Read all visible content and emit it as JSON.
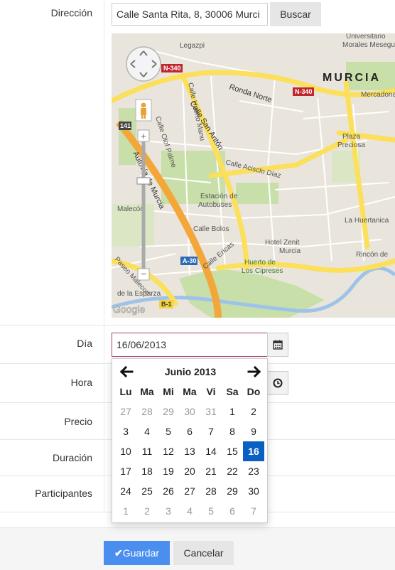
{
  "form": {
    "address": {
      "label": "Dirección",
      "value": "Calle Santa Rita, 8, 30006 Murci",
      "search_label": "Buscar"
    },
    "day": {
      "label": "Día",
      "value": "16/06/2013"
    },
    "hour": {
      "label": "Hora"
    },
    "price": {
      "label": "Precio"
    },
    "duration": {
      "label": "Duración"
    },
    "participants": {
      "label": "Participantes"
    }
  },
  "map": {
    "labels": {
      "murcia": "MURCIA",
      "universitario": "Universitario",
      "morales": "Morales Meseguer",
      "mercadona": "Mercadona",
      "plaza": "Plaza",
      "preciosa": "Preciosa",
      "ronda_norte": "Ronda Norte",
      "n340_a": "N-340",
      "n340_b": "N-340",
      "calle_huerto": "Calle Huerto Manu",
      "calle_san_anton": "Calle San Antón",
      "calle_olof": "Calle Olof Palme",
      "calle_acisclo": "Calle Acisclo Díaz",
      "estacion": "Estación de",
      "autobuses": "Autobuses",
      "autovia": "Autovía de Murcia",
      "calle_bolos": "Calle Bolos",
      "calle_ericas": "Calle Ericas",
      "hotel_zenit": "Hotel Zenit",
      "hotel_murcia": "Murcia",
      "huerto": "Huerto de",
      "cipreses": "Los Cipreses",
      "huertanica": "La Huertanica",
      "rincon": "Rincón de",
      "malecon": "Malecón",
      "paseo_malecon": "Paseo Malecon",
      "esparza": "de la Esparza",
      "a30": "A-30",
      "b1": "B-1",
      "n141": "141",
      "lagazpi": "Legazpi",
      "google": "Google"
    },
    "colors": {
      "land": "#e9e5dc",
      "road": "#ffffff",
      "major": "#fcdf5a",
      "highway": "#f3a73a",
      "park": "#c8dfaa",
      "water": "#9ec3e8"
    }
  },
  "calendar": {
    "title": "Junio 2013",
    "weekdays": [
      "Lu",
      "Ma",
      "Mi",
      "Ma",
      "Vi",
      "Sa",
      "Do"
    ],
    "weeks": [
      [
        "27",
        "28",
        "29",
        "30",
        "31",
        "1",
        "2"
      ],
      [
        "3",
        "4",
        "5",
        "6",
        "7",
        "8",
        "9"
      ],
      [
        "10",
        "11",
        "12",
        "13",
        "14",
        "15",
        "16"
      ],
      [
        "17",
        "18",
        "19",
        "20",
        "21",
        "22",
        "23"
      ],
      [
        "24",
        "25",
        "26",
        "27",
        "28",
        "29",
        "30"
      ],
      [
        "1",
        "2",
        "3",
        "4",
        "5",
        "6",
        "7"
      ]
    ],
    "selected": "16",
    "muted_first_week": [
      0,
      1,
      2,
      3,
      4
    ],
    "muted_last_week": [
      0,
      1,
      2,
      3,
      4,
      5,
      6
    ],
    "selected_color": "#0a5fc2"
  },
  "actions": {
    "save_label": "Guardar",
    "cancel_label": "Cancelar"
  }
}
